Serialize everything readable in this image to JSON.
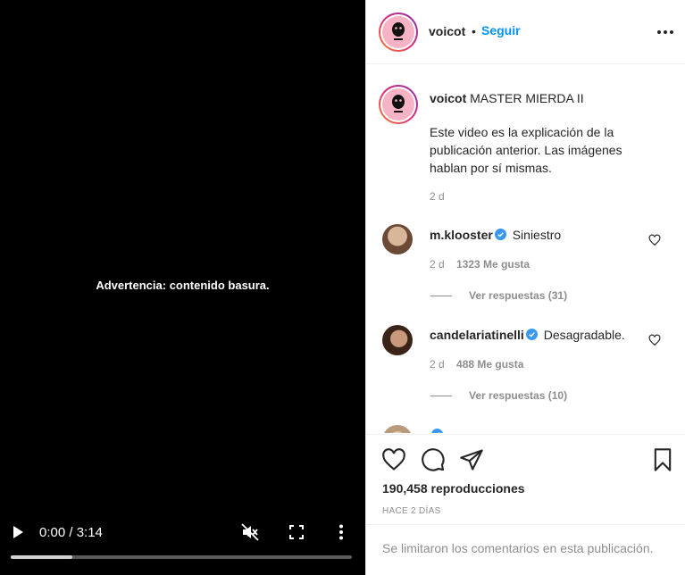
{
  "video": {
    "warning_text": "Advertencia: contenido basura.",
    "time_display": "0:00 / 3:14",
    "progress_fraction": 0.18,
    "icons": [
      "play-icon",
      "muted-icon",
      "fullscreen-icon",
      "more-vertical-icon"
    ]
  },
  "header": {
    "username": "voicot",
    "separator": "•",
    "follow_label": "Seguir",
    "more_icon": "more-horizontal-icon"
  },
  "caption": {
    "username": "voicot",
    "title": "MASTER MIERDA II",
    "body": "Este video es la explicación de la publicación anterior. Las imágenes hablan por sí mismas.",
    "time": "2 d"
  },
  "comments": [
    {
      "username": "m.klooster",
      "verified": true,
      "text": "Siniestro",
      "time": "2 d",
      "likes": "1323 Me gusta",
      "replies": "Ver respuestas (31)"
    },
    {
      "username": "candelariatinelli",
      "verified": true,
      "text": "Desagradable.",
      "time": "2 d",
      "likes": "488 Me gusta",
      "replies": "Ver respuestas (10)"
    },
    {
      "username": "",
      "verified": true,
      "text": "",
      "time": "",
      "likes": "",
      "replies": ""
    }
  ],
  "actions": {
    "icons": [
      "heart-icon",
      "comment-icon",
      "share-icon",
      "bookmark-icon"
    ],
    "views": "190,458 reproducciones",
    "posted_ago": "HACE 2 DÍAS",
    "comments_limited": "Se limitaron los comentarios en esta publicación."
  },
  "colors": {
    "accent_blue": "#0095f6",
    "secondary_text": "#8e8e8e",
    "primary_text": "#262626",
    "video_bg": "#000000"
  }
}
